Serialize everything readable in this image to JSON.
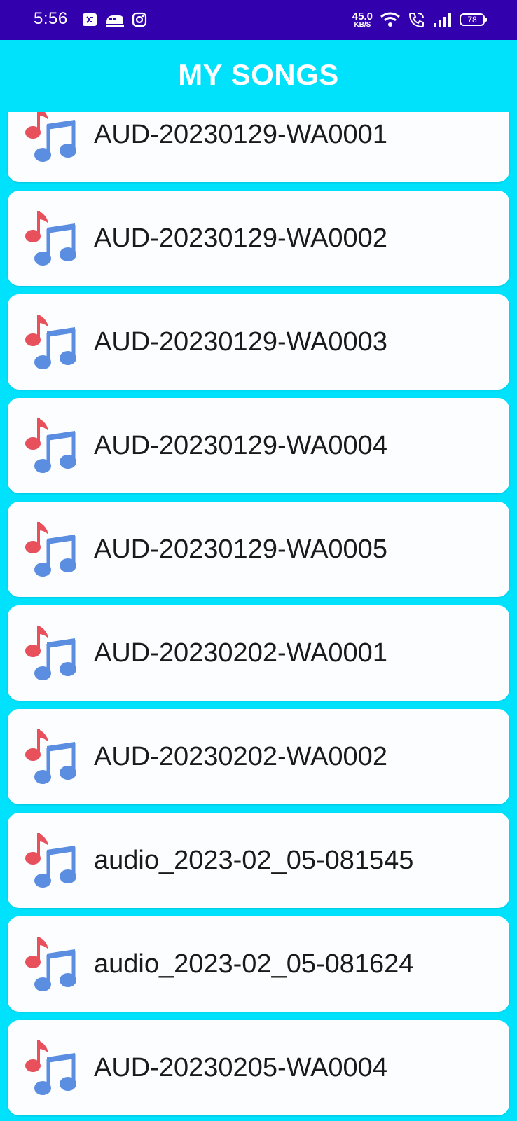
{
  "status_bar": {
    "time": "5:56",
    "left_icons": [
      "notification-app-icon",
      "train-icon",
      "instagram-icon"
    ],
    "speed_value": "45.0",
    "speed_unit": "KB/S",
    "right_icons": [
      "wifi-icon",
      "wifi-calling-icon",
      "signal-icon"
    ],
    "battery": "78"
  },
  "app_bar": {
    "title": "MY SONGS"
  },
  "songs": [
    {
      "title": "AUD-20230129-WA0001",
      "icon": "music-note-icon"
    },
    {
      "title": "AUD-20230129-WA0002",
      "icon": "music-note-icon"
    },
    {
      "title": "AUD-20230129-WA0003",
      "icon": "music-note-icon"
    },
    {
      "title": "AUD-20230129-WA0004",
      "icon": "music-note-icon"
    },
    {
      "title": "AUD-20230129-WA0005",
      "icon": "music-note-icon"
    },
    {
      "title": "AUD-20230202-WA0001",
      "icon": "music-note-icon"
    },
    {
      "title": "AUD-20230202-WA0002",
      "icon": "music-note-icon"
    },
    {
      "title": "audio_2023-02_05-081545",
      "icon": "music-note-icon"
    },
    {
      "title": "audio_2023-02_05-081624",
      "icon": "music-note-icon"
    },
    {
      "title": "AUD-20230205-WA0004",
      "icon": "music-note-icon"
    }
  ],
  "colors": {
    "status_bar": "#3300AE",
    "background": "#00E1FC",
    "card": "#FCFDFF",
    "note_red": "#E8505B",
    "note_blue": "#5B8DE0"
  }
}
